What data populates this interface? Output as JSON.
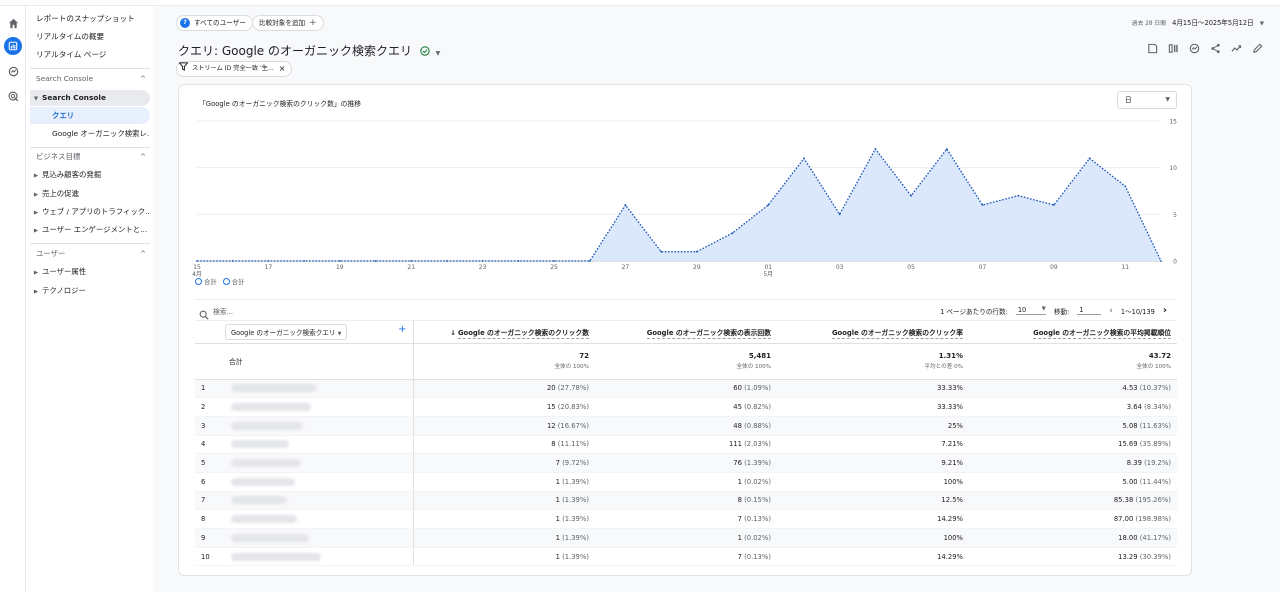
{
  "sidebar": {
    "top_items": [
      "レポートのスナップショット",
      "リアルタイムの概要",
      "リアルタイム ページ"
    ],
    "section_search_console": "Search Console",
    "search_console_tree": "Search Console",
    "search_console_children": [
      "クエリ",
      "Google オーガニック検索レ..."
    ],
    "section_business": "ビジネス目標",
    "business_items": [
      "見込み顧客の発掘",
      "売上の促進",
      "ウェブ / アプリのトラフィック...",
      "ユーザー エンゲージメントと..."
    ],
    "section_user": "ユーザー",
    "user_items": [
      "ユーザー属性",
      "テクノロジー"
    ]
  },
  "header": {
    "segment_chip": "すべてのユーザー",
    "compare_chip": "比較対象を追加",
    "title": "クエリ: Google のオーガニック検索クエリ",
    "filter_chip": "ストリーム ID 完全一致 '生...",
    "date_prefix": "過去 28 日間",
    "date_range": "4月15日～2025年5月12日"
  },
  "chart": {
    "title": "「Google のオーガニック検索のクリック数」の推移",
    "granularity": "日",
    "legend": [
      "合計",
      "合計"
    ]
  },
  "chart_data": {
    "type": "area",
    "x": [
      "04-15",
      "04-16",
      "04-17",
      "04-18",
      "04-19",
      "04-20",
      "04-21",
      "04-22",
      "04-23",
      "04-24",
      "04-25",
      "04-26",
      "04-27",
      "04-28",
      "04-29",
      "04-30",
      "05-01",
      "05-02",
      "05-03",
      "05-04",
      "05-05",
      "05-06",
      "05-07",
      "05-08",
      "05-09",
      "05-10",
      "05-11",
      "05-12"
    ],
    "x_tick_labels": [
      "15",
      "17",
      "19",
      "21",
      "23",
      "25",
      "27",
      "29",
      "01",
      "03",
      "05",
      "07",
      "09",
      "11"
    ],
    "x_month_labels": [
      {
        "at": "04-15",
        "label": "4月"
      },
      {
        "at": "05-01",
        "label": "5月"
      }
    ],
    "series": [
      {
        "values": [
          0,
          0,
          0,
          0,
          0,
          0,
          0,
          0,
          0,
          0,
          0,
          0,
          6,
          1,
          1,
          3,
          6,
          11,
          5,
          12,
          7,
          12,
          6,
          7,
          6,
          11,
          8,
          0
        ]
      }
    ],
    "ylim": [
      0,
      15
    ],
    "y_ticks": [
      0,
      5,
      10,
      15
    ],
    "grid": true
  },
  "table_controls": {
    "search_placeholder": "検索...",
    "rows_per_page_label": "1 ページあたりの行数:",
    "rows_per_page": "10",
    "goto_label": "移動:",
    "goto_value": "1",
    "range": "1～10/139"
  },
  "table": {
    "dimension": "Google のオーガニック検索クエリ",
    "columns": [
      "Google のオーガニック検索のクリック数",
      "Google のオーガニック検索の表示回数",
      "Google のオーガニック検索のクリック率",
      "Google のオーガニック検索の平均掲載順位"
    ],
    "total_label": "合計",
    "totals": [
      {
        "value": "72",
        "sub": "全体の 100%"
      },
      {
        "value": "5,481",
        "sub": "全体の 100%"
      },
      {
        "value": "1.31%",
        "sub": "平均との差 0%"
      },
      {
        "value": "43.72",
        "sub": "全体の 100%"
      }
    ],
    "rows": [
      {
        "idx": "1",
        "clicks": "20",
        "clicks_pct": "(27.78%)",
        "imps": "60",
        "imps_pct": "(1.09%)",
        "ctr": "33.33%",
        "pos": "4.53",
        "pos_pct": "(10.37%)"
      },
      {
        "idx": "2",
        "clicks": "15",
        "clicks_pct": "(20.83%)",
        "imps": "45",
        "imps_pct": "(0.82%)",
        "ctr": "33.33%",
        "pos": "3.64",
        "pos_pct": "(8.34%)"
      },
      {
        "idx": "3",
        "clicks": "12",
        "clicks_pct": "(16.67%)",
        "imps": "48",
        "imps_pct": "(0.88%)",
        "ctr": "25%",
        "pos": "5.08",
        "pos_pct": "(11.63%)"
      },
      {
        "idx": "4",
        "clicks": "8",
        "clicks_pct": "(11.11%)",
        "imps": "111",
        "imps_pct": "(2.03%)",
        "ctr": "7.21%",
        "pos": "15.69",
        "pos_pct": "(35.89%)"
      },
      {
        "idx": "5",
        "clicks": "7",
        "clicks_pct": "(9.72%)",
        "imps": "76",
        "imps_pct": "(1.39%)",
        "ctr": "9.21%",
        "pos": "8.39",
        "pos_pct": "(19.2%)"
      },
      {
        "idx": "6",
        "clicks": "1",
        "clicks_pct": "(1.39%)",
        "imps": "1",
        "imps_pct": "(0.02%)",
        "ctr": "100%",
        "pos": "5.00",
        "pos_pct": "(11.44%)"
      },
      {
        "idx": "7",
        "clicks": "1",
        "clicks_pct": "(1.39%)",
        "imps": "8",
        "imps_pct": "(0.15%)",
        "ctr": "12.5%",
        "pos": "85.38",
        "pos_pct": "(195.26%)"
      },
      {
        "idx": "8",
        "clicks": "1",
        "clicks_pct": "(1.39%)",
        "imps": "7",
        "imps_pct": "(0.13%)",
        "ctr": "14.29%",
        "pos": "87.00",
        "pos_pct": "(198.98%)"
      },
      {
        "idx": "9",
        "clicks": "1",
        "clicks_pct": "(1.39%)",
        "imps": "1",
        "imps_pct": "(0.02%)",
        "ctr": "100%",
        "pos": "18.00",
        "pos_pct": "(41.17%)"
      },
      {
        "idx": "10",
        "clicks": "1",
        "clicks_pct": "(1.39%)",
        "imps": "7",
        "imps_pct": "(0.13%)",
        "ctr": "14.29%",
        "pos": "13.29",
        "pos_pct": "(30.39%)"
      }
    ]
  },
  "colors": {
    "accent": "#1a73e8",
    "area_fill": "#dbe7fb"
  }
}
